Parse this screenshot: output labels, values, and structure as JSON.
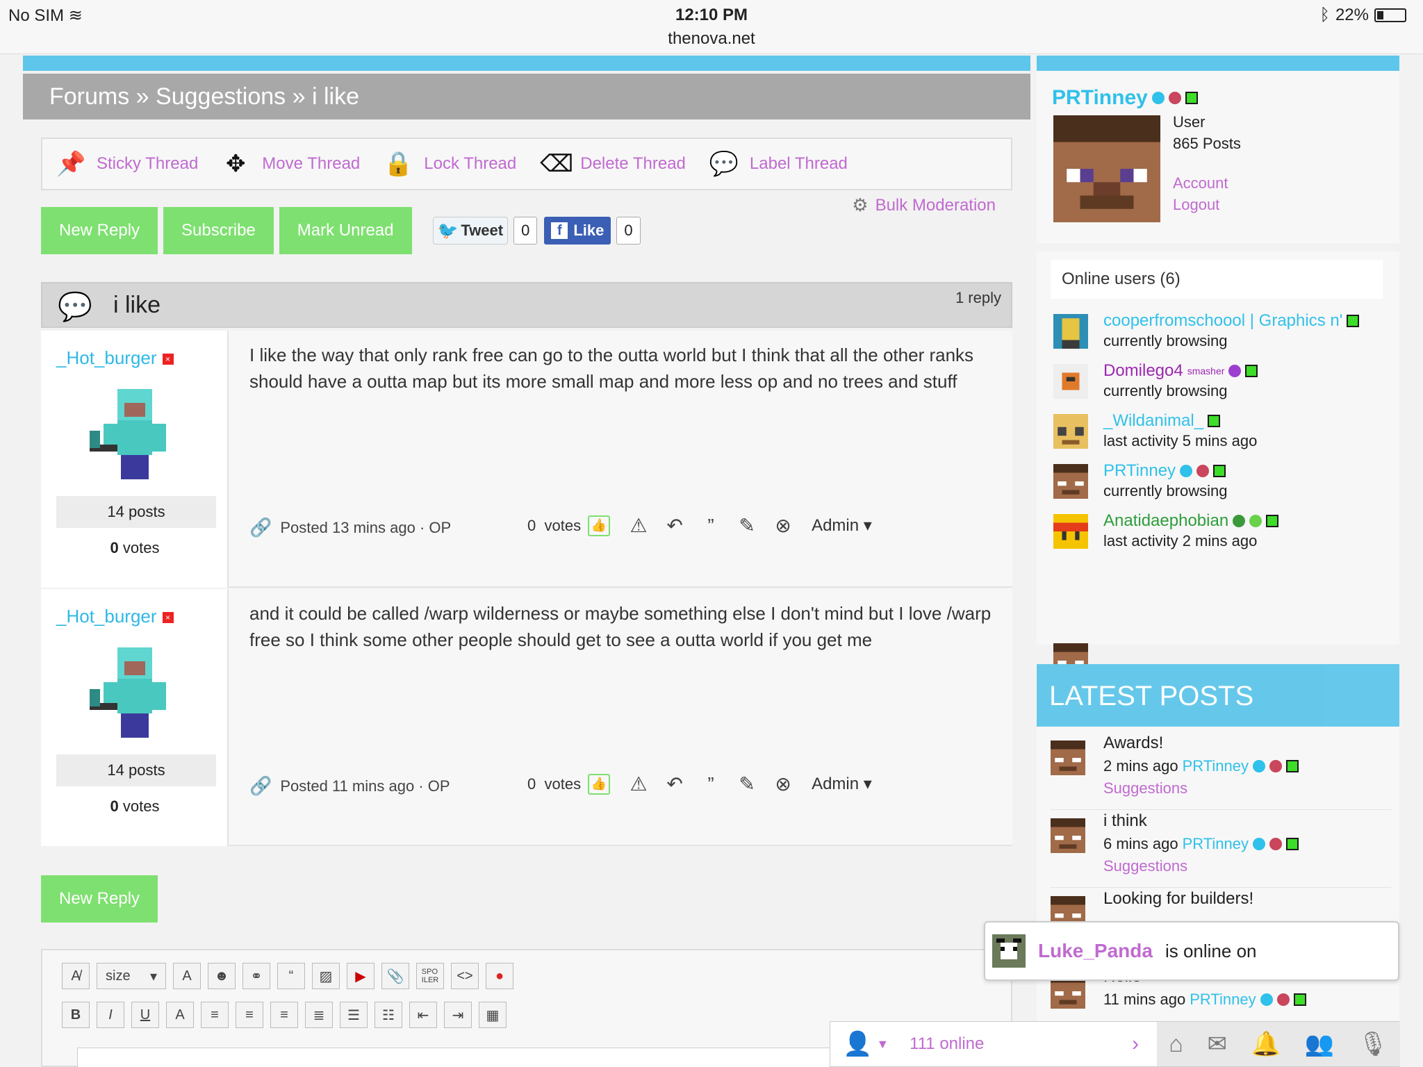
{
  "status_bar": {
    "carrier": "No SIM",
    "time": "12:10 PM",
    "url": "thenova.net",
    "battery": "22%",
    "battery_level": 0.22
  },
  "breadcrumb": "Forums » Suggestions » i like",
  "moderation": {
    "items": [
      {
        "icon": "pin-icon",
        "label": "Sticky Thread"
      },
      {
        "icon": "move-icon",
        "label": "Move Thread"
      },
      {
        "icon": "lock-icon",
        "label": "Lock Thread"
      },
      {
        "icon": "delete-icon",
        "label": "Delete Thread"
      },
      {
        "icon": "label-icon",
        "label": "Label Thread"
      }
    ],
    "bulk": "Bulk Moderation"
  },
  "buttons": {
    "new_reply": "New Reply",
    "subscribe": "Subscribe",
    "mark_unread": "Mark Unread"
  },
  "social": {
    "tweet": "Tweet",
    "tweet_count": "0",
    "like": "Like",
    "like_count": "0"
  },
  "thread": {
    "title": "i like",
    "replies": "1 reply"
  },
  "posts": [
    {
      "author": "_Hot_burger",
      "posts": "14 posts",
      "votes_num": "0",
      "votes_label": "votes",
      "body": "I like the way that only rank free can go to the outta world but I think that all the other ranks should have a outta map but its more small map and more less op and no trees and stuff",
      "posted": "Posted 13 mins ago · OP",
      "vote_count": "0",
      "vote_label": "votes",
      "admin": "Admin"
    },
    {
      "author": "_Hot_burger",
      "posts": "14 posts",
      "votes_num": "0",
      "votes_label": "votes",
      "body": "and it could be called /warp wilderness or maybe something else I don't mind but I love /warp free so I think some other people should get to see a outta world if you get me",
      "posted": "Posted 11 mins ago · OP",
      "vote_count": "0",
      "vote_label": "votes",
      "admin": "Admin"
    }
  ],
  "editor": {
    "size_label": "size"
  },
  "profile": {
    "name": "PRTinney",
    "role": "User",
    "posts": "865 Posts",
    "account": "Account",
    "logout": "Logout"
  },
  "online": {
    "title": "Online users (6)",
    "users": [
      {
        "name": "cooperfromschoool | Graphics n'",
        "status": "currently browsing",
        "color": "#2fc1ea"
      },
      {
        "name": "Domilego4",
        "sup": "smasher",
        "status": "currently browsing",
        "color": "#9c27b0"
      },
      {
        "name": "_Wildanimal_",
        "status": "last activity 5 mins ago",
        "color": "#2fc1ea"
      },
      {
        "name": "PRTinney",
        "status": "currently browsing",
        "color": "#2fc1ea"
      },
      {
        "name": "Anatidaephobian",
        "status": "last activity 2 mins ago",
        "color": "#2e9d3a"
      }
    ]
  },
  "latest": {
    "title": "LATEST POSTS",
    "posts": [
      {
        "title": "Awards!",
        "time": "2 mins ago",
        "user": "PRTinney",
        "category": "Suggestions"
      },
      {
        "title": "i think",
        "time": "6 mins ago",
        "user": "PRTinney",
        "category": "Suggestions"
      },
      {
        "title": "Looking for builders!",
        "time": "",
        "user": "",
        "category": ""
      },
      {
        "title": "Hello",
        "time": "11 mins ago",
        "user": "PRTinney",
        "category": ""
      }
    ]
  },
  "toast": {
    "user": "Luke_Panda",
    "message": "is online on"
  },
  "bottom_bar": {
    "online": "111 online"
  }
}
